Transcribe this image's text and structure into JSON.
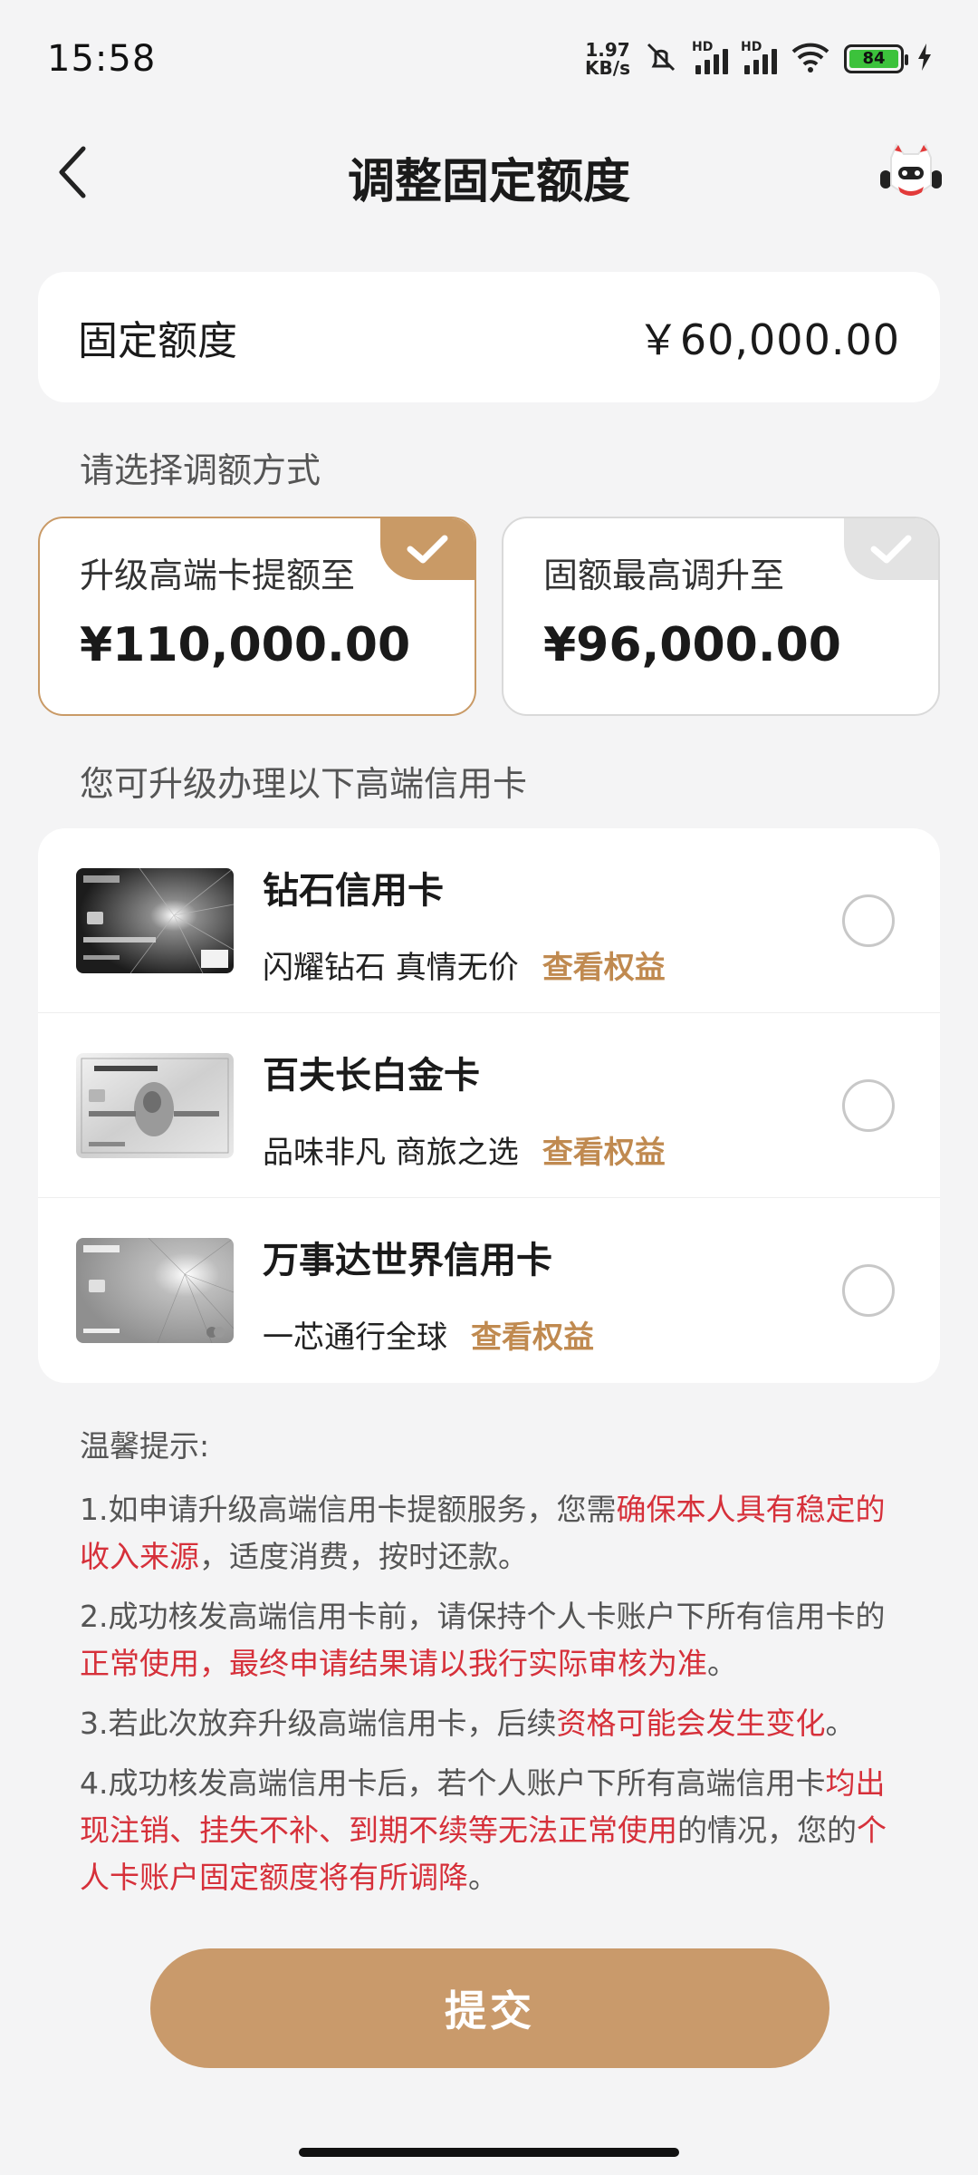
{
  "status_bar": {
    "time": "15:58",
    "net_speed_value": "1.97",
    "net_speed_unit": "KB/s",
    "hd_label": "HD",
    "battery": "84"
  },
  "header": {
    "title": "调整固定额度"
  },
  "fixed_limit": {
    "label": "固定额度",
    "amount": "￥60,000.00"
  },
  "method": {
    "section_label": "请选择调额方式",
    "options": [
      {
        "title": "升级高端卡提额至",
        "amount": "¥110,000.00",
        "selected": true
      },
      {
        "title": "固额最高调升至",
        "amount": "¥96,000.00",
        "selected": false
      }
    ]
  },
  "upgrade": {
    "section_label": "您可升级办理以下高端信用卡",
    "cards": [
      {
        "name": "钻石信用卡",
        "slogan": "闪耀钻石 真情无价",
        "link": "查看权益"
      },
      {
        "name": "百夫长白金卡",
        "slogan": "品味非凡 商旅之选",
        "link": "查看权益"
      },
      {
        "name": "万事达世界信用卡",
        "slogan": "一芯通行全球",
        "link": "查看权益"
      }
    ]
  },
  "tips": {
    "title": "温馨提示:",
    "t1_a": "1.如申请升级高端信用卡提额服务，您需",
    "t1_b": "确保本人具有稳定的收入来源",
    "t1_c": "，适度消费，按时还款。",
    "t2_a": "2.成功核发高端信用卡前，请保持个人卡账户下所有信用卡的",
    "t2_b": "正常使用，最终申请结果请以我行实际审核为准",
    "t2_c": "。",
    "t3_a": "3.若此次放弃升级高端信用卡，后续",
    "t3_b": "资格可能会发生变化",
    "t3_c": "。",
    "t4_a": "4.成功核发高端信用卡后，若个人账户下所有高端信用卡",
    "t4_b": "均出现注销、挂失不补、到期不续等无法正常使用",
    "t4_c": "的情况，您的",
    "t4_d": "个人卡账户固定额度将有所调降",
    "t4_e": "。"
  },
  "submit_label": "提交",
  "colors": {
    "accent": "#c99a6b",
    "link": "#c08a50",
    "highlight": "#d6303a",
    "background": "#f4f4f5"
  }
}
